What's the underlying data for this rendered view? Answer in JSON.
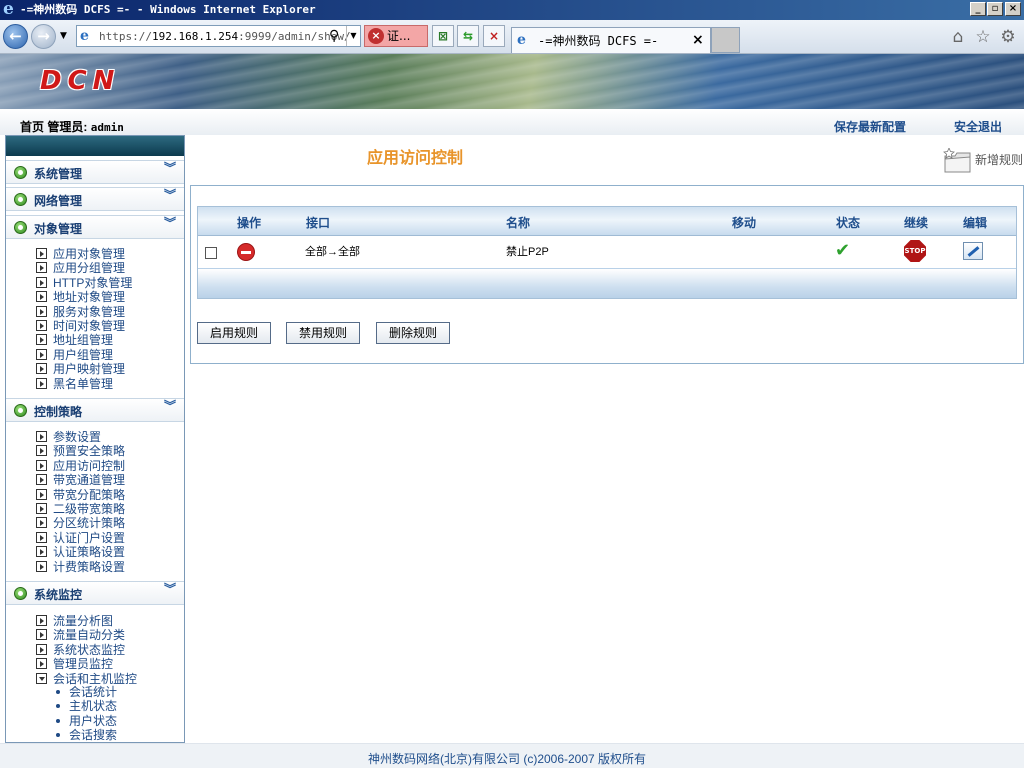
{
  "window": {
    "title": "-=神州数码 DCFS =- - Windows Internet Explorer"
  },
  "browser": {
    "url_prefix": "https://",
    "url_host": "192.168.1.254",
    "url_path": ":9999/admin/show/",
    "cert_error": "证...",
    "tab_label": "-=神州数码 DCFS =-"
  },
  "banner": {
    "logo": "DCN"
  },
  "subbar": {
    "home": "首页",
    "admin_label": "管理员:",
    "admin_name": "admin",
    "save_config": "保存最新配置",
    "logout": "安全退出"
  },
  "sidebar": {
    "sections": [
      {
        "label": "系统管理"
      },
      {
        "label": "网络管理"
      },
      {
        "label": "对象管理"
      },
      {
        "label": "控制策略"
      },
      {
        "label": "系统监控"
      }
    ],
    "object_items": [
      "应用对象管理",
      "应用分组管理",
      "HTTP对象管理",
      "地址对象管理",
      "服务对象管理",
      "时间对象管理",
      "地址组管理",
      "用户组管理",
      "用户映射管理",
      "黑名单管理"
    ],
    "policy_items": [
      "参数设置",
      "预置安全策略",
      "应用访问控制",
      "带宽通道管理",
      "带宽分配策略",
      "二级带宽策略",
      "分区统计策略",
      "认证门户设置",
      "认证策略设置",
      "计费策略设置"
    ],
    "monitor_items": [
      "流量分析图",
      "流量自动分类",
      "系统状态监控",
      "管理员监控",
      "会话和主机监控"
    ],
    "monitor_subitems": [
      "会话统计",
      "主机状态",
      "用户状态",
      "会话搜索"
    ]
  },
  "main": {
    "title": "应用访问控制",
    "add_rule": "新增规则",
    "table": {
      "headers": [
        "操作",
        "接口",
        "名称",
        "移动",
        "状态",
        "继续",
        "编辑"
      ],
      "rows": [
        {
          "interface": "全部→全部",
          "name": "禁止P2P",
          "status": "enabled",
          "continue": "STOP"
        }
      ]
    },
    "buttons": {
      "enable": "启用规则",
      "disable": "禁用规则",
      "delete": "删除规则"
    }
  },
  "footer": {
    "text": "神州数码网络(北京)有限公司 (c)2006-2007 版权所有"
  },
  "colors": {
    "accent_title": "#e8942a",
    "link_blue": "#1f4e8c",
    "enabled_green": "#2ea12e",
    "stop_red": "#b01515"
  }
}
